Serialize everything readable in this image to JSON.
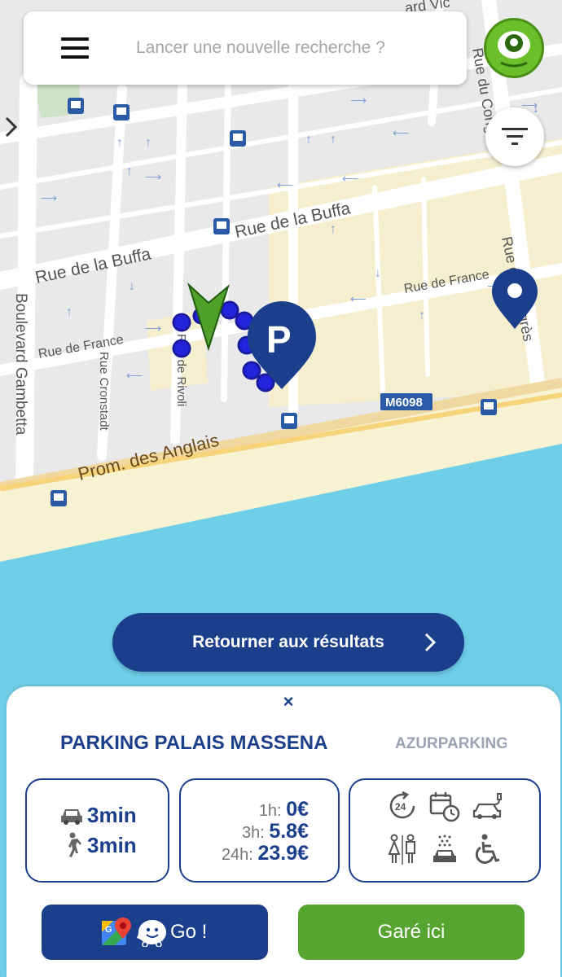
{
  "search": {
    "placeholder": "Lancer une nouvelle recherche ?"
  },
  "map": {
    "streets": {
      "rue_de_la_buffa_1": "Rue de la Buffa",
      "rue_de_la_buffa_2": "Rue de la Buffa",
      "rue_de_france_1": "Rue de France",
      "rue_de_france_2": "Rue de France",
      "boulevard_gambetta": "Boulevard Gambetta",
      "rue_cronstadt": "Rue Cronstadt",
      "rue_de_rivoli": "Rue de Rivoli",
      "prom_des_anglais": "Prom. des Anglais",
      "route_badge": "M6098",
      "rue_du_congres_top": "Rue du Congrès",
      "rue_congres_right": "Rue du Congrès",
      "top_fragment": "ard Vic"
    },
    "parking_marker_letter": "P"
  },
  "colors": {
    "brand_blue": "#1c3f8c",
    "brand_green": "#55a530",
    "sea": "#6fcfe9",
    "beach": "#f7f2d1",
    "street": "#ffffff",
    "block": "#ececec",
    "pedestrian": "#f7f0d0"
  },
  "results_button": {
    "label": "Retourner aux résultats"
  },
  "panel": {
    "close_label": "×",
    "parking_name": "PARKING PALAIS MASSENA",
    "operator": "AZURPARKING",
    "drive_time": "3min",
    "walk_time": "3min",
    "prices": [
      {
        "label": "1h:",
        "value": "0€"
      },
      {
        "label": "3h:",
        "value": "5.8€"
      },
      {
        "label": "24h:",
        "value": "23.9€"
      }
    ],
    "services": [
      "24h-icon",
      "calendar-clock-icon",
      "ev-charging-icon",
      "restroom-icon",
      "car-wash-icon",
      "wheelchair-icon"
    ],
    "go_label": "Go !",
    "park_label": "Garé ici"
  }
}
